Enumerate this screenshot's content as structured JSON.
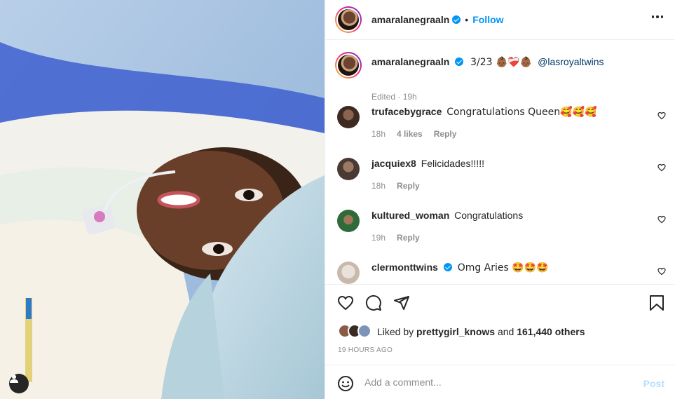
{
  "post": {
    "author": "amaralanegraaln",
    "follow_label": "Follow",
    "header_separator": "•",
    "more_icon": "more-horizontal-icon"
  },
  "caption": {
    "username": "amaralanegraaln",
    "text": "3/23 👶🏾❤️‍🩹👶🏾",
    "mention": "@lasroyaltwins",
    "edited": "Edited",
    "meta_separator": " · ",
    "age": "19h"
  },
  "comments": [
    {
      "username": "trufacebygrace",
      "text": "Congratulations Queen🥰🥰🥰",
      "age": "18h",
      "likes": "4 likes",
      "reply": "Reply",
      "avatar_color": "#5a3d2e"
    },
    {
      "username": "jacquiex8",
      "text": "Felicidades!!!!!",
      "age": "18h",
      "likes": "",
      "reply": "Reply",
      "avatar_color": "#4a3a33"
    },
    {
      "username": "kultured_woman",
      "text": "Congratulations",
      "age": "19h",
      "likes": "",
      "reply": "Reply",
      "avatar_color": "#2f6b3a"
    },
    {
      "username": "clermonttwins",
      "text": "Omg Aries 🤩🤩🤩",
      "age": "",
      "likes": "",
      "reply": "",
      "avatar_color": "#c8b9aa",
      "verified": true
    }
  ],
  "actions": {
    "like_icon": "heart-icon",
    "comment_icon": "comment-icon",
    "share_icon": "share-icon",
    "save_icon": "bookmark-icon"
  },
  "likes": {
    "prefix": "Liked by ",
    "first_liker": "prettygirl_knows",
    "and": " and ",
    "count": "161,440 others"
  },
  "timestamp": "19 HOURS AGO",
  "composer": {
    "placeholder": "Add a comment...",
    "post_label": "Post"
  },
  "colors": {
    "accent": "#0095f6",
    "post_disabled": "#b2dffc",
    "muted": "#8e8e8e"
  }
}
